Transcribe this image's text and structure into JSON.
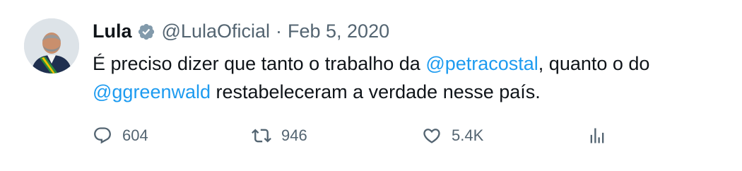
{
  "tweet": {
    "author_name": "Lula",
    "handle": "@LulaOficial",
    "separator": "·",
    "date": "Feb 5, 2020",
    "text_part1": "É preciso dizer que tanto o trabalho da ",
    "mention1": "@petracostal",
    "text_part2": ", quanto o do ",
    "mention2": "@ggreenwald",
    "text_part3": " restabeleceram a verdade nesse país."
  },
  "actions": {
    "replies": "604",
    "retweets": "946",
    "likes": "5.4K"
  },
  "icons": {
    "verified": "verified-badge-icon",
    "reply": "reply-icon",
    "retweet": "retweet-icon",
    "like": "heart-icon",
    "views": "views-icon"
  },
  "colors": {
    "text": "#0f1419",
    "muted": "#536471",
    "accent": "#1d9bf0"
  }
}
